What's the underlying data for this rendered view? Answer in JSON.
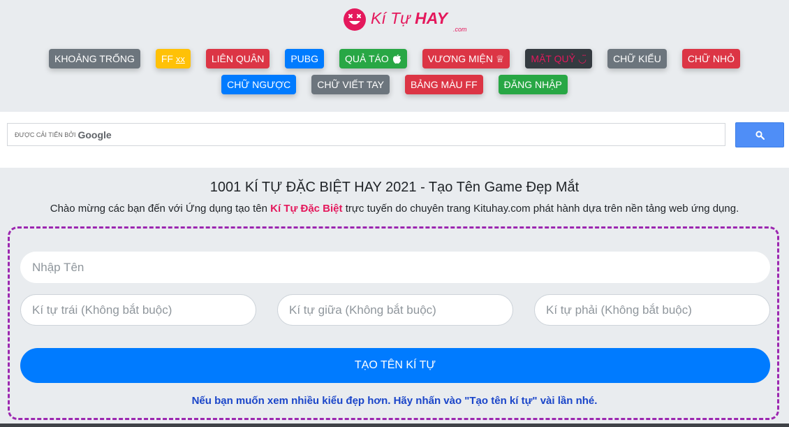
{
  "logo": {
    "ki_tu": "Kí Tự",
    "hay": "HAY",
    "com": ".com"
  },
  "nav": {
    "row1": [
      {
        "label": "KHOẢNG TRỐNG",
        "color": "gray"
      },
      {
        "label": "FF ",
        "suffix": "xx",
        "color": "yellow"
      },
      {
        "label": "LIÊN QUÂN",
        "color": "red"
      },
      {
        "label": "PUBG",
        "color": "blue"
      },
      {
        "label": "QUẢ TÁO",
        "color": "green",
        "icon": "apple-icon"
      },
      {
        "label": "VƯƠNG MIỆN ♕",
        "color": "red"
      },
      {
        "label": "MẶT QUỶ ◡̈",
        "color": "dark"
      },
      {
        "label": "CHỮ KIỂU",
        "color": "gray"
      },
      {
        "label": "CHỮ NHỎ",
        "color": "red"
      }
    ],
    "row2": [
      {
        "label": "CHỮ NGƯỢC",
        "color": "blue"
      },
      {
        "label": "CHỮ VIẾT TAY",
        "color": "gray"
      },
      {
        "label": "BẢNG MÀU FF",
        "color": "red"
      },
      {
        "label": "ĐĂNG NHẬP",
        "color": "green"
      }
    ]
  },
  "search": {
    "hint": "ĐƯỢC CẢI TIẾN BỞI",
    "brand": "Google"
  },
  "main": {
    "title": "1001 KÍ TỰ ĐẶC BIỆT HAY 2021 - Tạo Tên Game Đẹp Mắt",
    "intro_before": "Chào mừng các bạn đến với Ứng dụng tạo tên ",
    "intro_em": "Kí Tự Đặc Biệt",
    "intro_after": " trực tuyến do chuyên trang Kituhay.com phát hành dựa trên nền tảng web ứng dụng."
  },
  "form": {
    "name_placeholder": "Nhập Tên",
    "left_placeholder": "Kí tự trái (Không bắt buộc)",
    "mid_placeholder": "Kí tự giữa (Không bắt buộc)",
    "right_placeholder": "Kí tự phải (Không bắt buộc)",
    "create_label": "TẠO TÊN KÍ TỰ",
    "hint": "Nếu bạn muốn xem nhiều kiểu đẹp hơn. Hãy nhấn vào \"Tạo tên kí tự\" vài lần nhé."
  },
  "colors": {
    "brand": "#e4185c",
    "primary": "#007bff",
    "dashed_border": "#9c27b0",
    "hint": "#1a45c9"
  }
}
